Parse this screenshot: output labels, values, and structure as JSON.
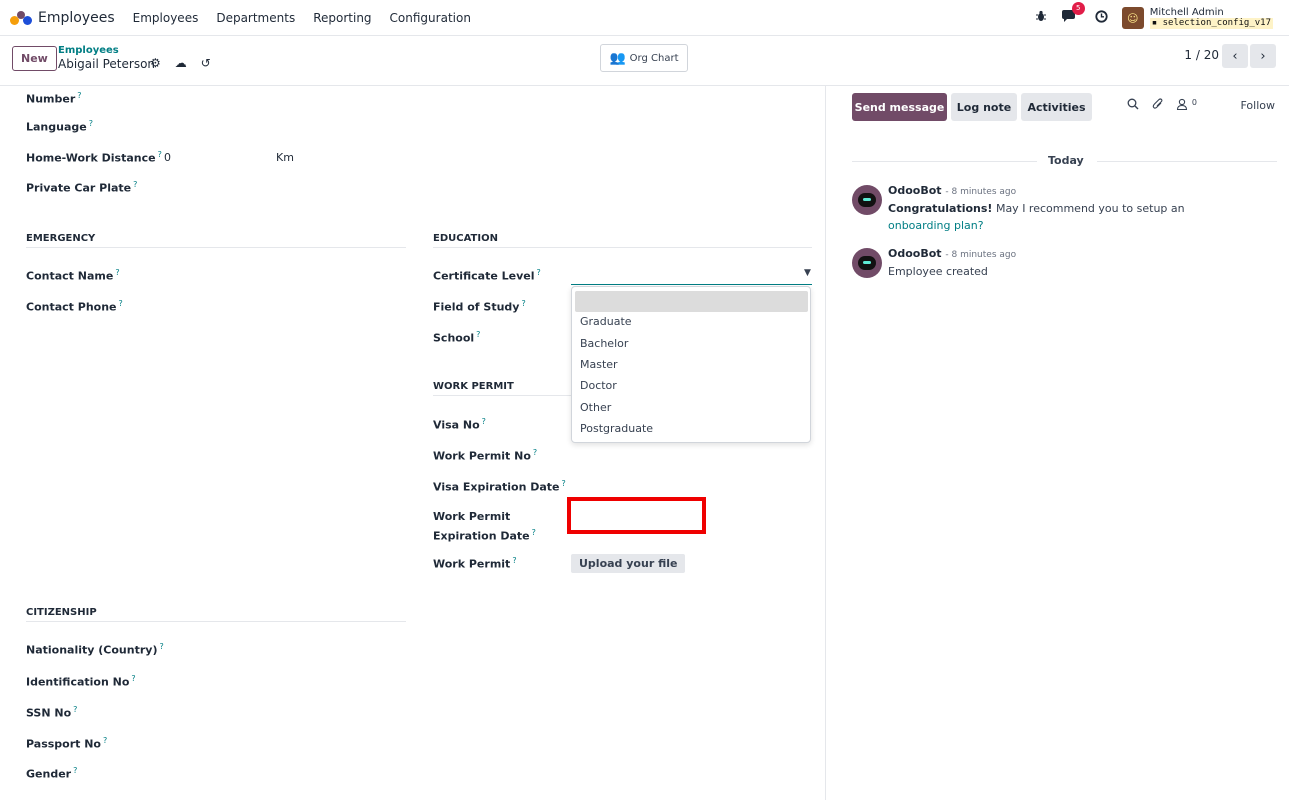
{
  "navbar": {
    "app_title": "Employees",
    "menu": [
      "Employees",
      "Departments",
      "Reporting",
      "Configuration"
    ],
    "message_badge": "5",
    "user_name": "Mitchell Admin",
    "db_name": "selection_config_v17",
    "icons": [
      "bug-icon",
      "chat-icon",
      "clock-icon"
    ]
  },
  "control": {
    "new_label": "New",
    "breadcrumb_parent": "Employees",
    "breadcrumb_current": "Abigail Peterson",
    "org_chart_label": "Org Chart",
    "pager": "1 / 20"
  },
  "form": {
    "fields_top": {
      "number": "Number",
      "language": "Language",
      "home_work_distance": "Home-Work Distance",
      "home_work_distance_value": "0",
      "home_work_distance_unit": "Km",
      "private_car_plate": "Private Car Plate"
    },
    "emergency": {
      "title": "EMERGENCY",
      "contact_name": "Contact Name",
      "contact_phone": "Contact Phone"
    },
    "education": {
      "title": "EDUCATION",
      "certificate_level": "Certificate Level",
      "field_of_study": "Field of Study",
      "school": "School"
    },
    "work_permit": {
      "title": "WORK PERMIT",
      "visa_no": "Visa No",
      "work_permit_no": "Work Permit No",
      "visa_expiration_date": "Visa Expiration Date",
      "work_permit_expiration_line1": "Work Permit",
      "work_permit_expiration_line2": "Expiration Date",
      "work_permit": "Work Permit",
      "upload_label": "Upload your file"
    },
    "citizenship": {
      "title": "CITIZENSHIP",
      "nationality": "Nationality (Country)",
      "identification_no": "Identification No",
      "ssn_no": "SSN No",
      "passport_no": "Passport No",
      "gender": "Gender"
    },
    "help_mark": "?"
  },
  "dropdown": {
    "options": [
      "Graduate",
      "Bachelor",
      "Master",
      "Doctor",
      "Other",
      "Postgraduate"
    ],
    "highlighted": "Postgraduate"
  },
  "chatter": {
    "send_message": "Send message",
    "log_note": "Log note",
    "activities": "Activities",
    "followers_count": "0",
    "follow": "Follow",
    "today": "Today",
    "messages": [
      {
        "author": "OdooBot",
        "time": "- 8 minutes ago",
        "bold": "Congratulations!",
        "text": " May I recommend you to setup an",
        "link": "onboarding plan?"
      },
      {
        "author": "OdooBot",
        "time": "- 8 minutes ago",
        "text": "Employee created"
      }
    ]
  },
  "colors": {
    "brand": "#714b67",
    "link": "#017e84",
    "highlight": "#ef0000"
  }
}
